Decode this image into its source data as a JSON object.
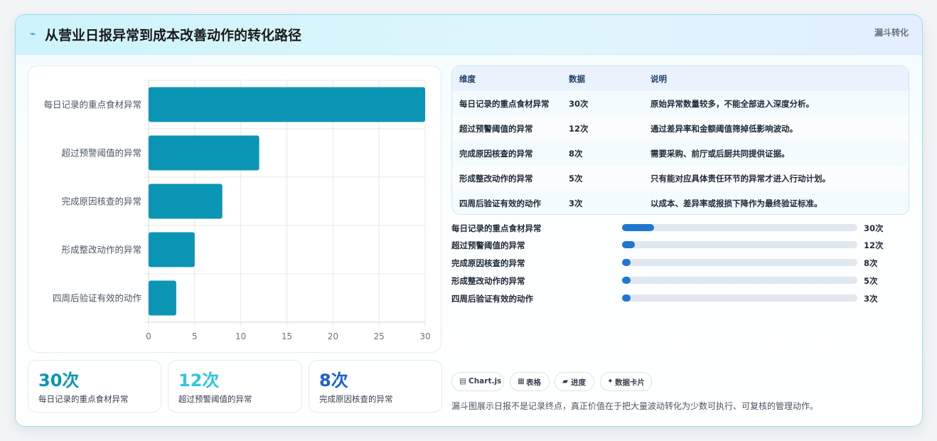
{
  "header": {
    "icon": "⌁",
    "title": "从营业日报异常到成本改善动作的转化路径",
    "tag": "漏斗转化"
  },
  "chart_data": {
    "type": "bar",
    "orientation": "horizontal",
    "categories": [
      "每日记录的重点食材异常",
      "超过预警阈值的异常",
      "完成原因核查的异常",
      "形成整改动作的异常",
      "四周后验证有效的动作"
    ],
    "values": [
      30,
      12,
      8,
      5,
      3
    ],
    "xlim": [
      0,
      30
    ],
    "xticks": [
      "0",
      "5",
      "10",
      "15",
      "20",
      "25",
      "30"
    ],
    "grid": true,
    "bar_color": "#0b95b5"
  },
  "stats": [
    {
      "value": "30次",
      "label": "每日记录的重点食材异常",
      "color": "#0b95b5"
    },
    {
      "value": "12次",
      "label": "超过预警阈值的异常",
      "color": "#2fc7e0"
    },
    {
      "value": "8次",
      "label": "完成原因核查的异常",
      "color": "#1e5fd1"
    }
  ],
  "table": {
    "headers": [
      "维度",
      "数据",
      "说明"
    ],
    "rows": [
      [
        "每日记录的重点食材异常",
        "30次",
        "原始异常数量较多，不能全部进入深度分析。"
      ],
      [
        "超过预警阈值的异常",
        "12次",
        "通过差异率和金额阈值筛掉低影响波动。"
      ],
      [
        "完成原因核查的异常",
        "8次",
        "需要采购、前厅或后厨共同提供证据。"
      ],
      [
        "形成整改动作的异常",
        "5次",
        "只有能对应具体责任环节的异常才进入行动计划。"
      ],
      [
        "四周后验证有效的动作",
        "3次",
        "以成本、差异率或报损下降作为最终验证标准。"
      ]
    ]
  },
  "progress": [
    {
      "label": "每日记录的重点食材异常",
      "value": "30次",
      "fraction": 0.135
    },
    {
      "label": "超过预警阈值的异常",
      "value": "12次",
      "fraction": 0.054
    },
    {
      "label": "完成原因核查的异常",
      "value": "8次",
      "fraction": 0.036
    },
    {
      "label": "形成整改动作的异常",
      "value": "5次",
      "fraction": 0.036
    },
    {
      "label": "四周后验证有效的动作",
      "value": "3次",
      "fraction": 0.036
    }
  ],
  "chips": [
    {
      "icon": "▤",
      "label": "Chart.js"
    },
    {
      "icon": "▦",
      "label": "表格"
    },
    {
      "icon": "▰",
      "label": "进度"
    },
    {
      "icon": "✦",
      "label": "数据卡片"
    }
  ],
  "note": "漏斗图展示日报不是记录终点，真正价值在于把大量波动转化为少数可执行、可复核的管理动作。"
}
